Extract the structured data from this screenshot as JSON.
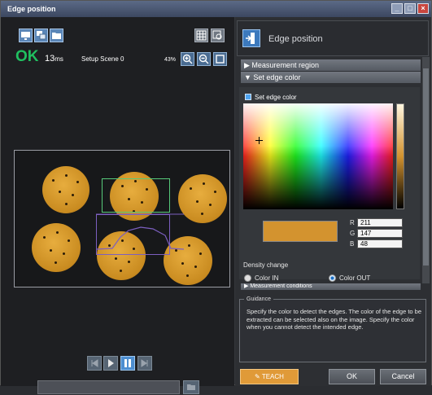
{
  "window": {
    "title": "Edge position"
  },
  "left": {
    "status": "OK",
    "time_value": "13",
    "time_unit": "ms",
    "scene": "Setup Scene 0",
    "zoom": "43%"
  },
  "right": {
    "header_title": "Edge position",
    "sections": {
      "measurement_region": "Measurement region",
      "set_edge_color": "Set edge color",
      "measurement_conditions": "Measurement conditions"
    },
    "set_edge_color_checkbox": "Set edge color",
    "rgb": {
      "r_label": "R",
      "r_value": "211",
      "g_label": "G",
      "g_value": "147",
      "b_label": "B",
      "b_value": "48"
    },
    "density_change_label": "Density change",
    "color_in": "Color IN",
    "color_out": "Color OUT",
    "selected_density": "Color OUT",
    "selected_color": "#d3932f",
    "guidance": {
      "title": "Guidance",
      "text": "Specify the color to detect the edges. The color of the edge to be extracted can be selected also on the image. Specify the color when you cannot detect the intended edge."
    },
    "buttons": {
      "teach": "TEACH",
      "ok": "OK",
      "cancel": "Cancel"
    }
  }
}
